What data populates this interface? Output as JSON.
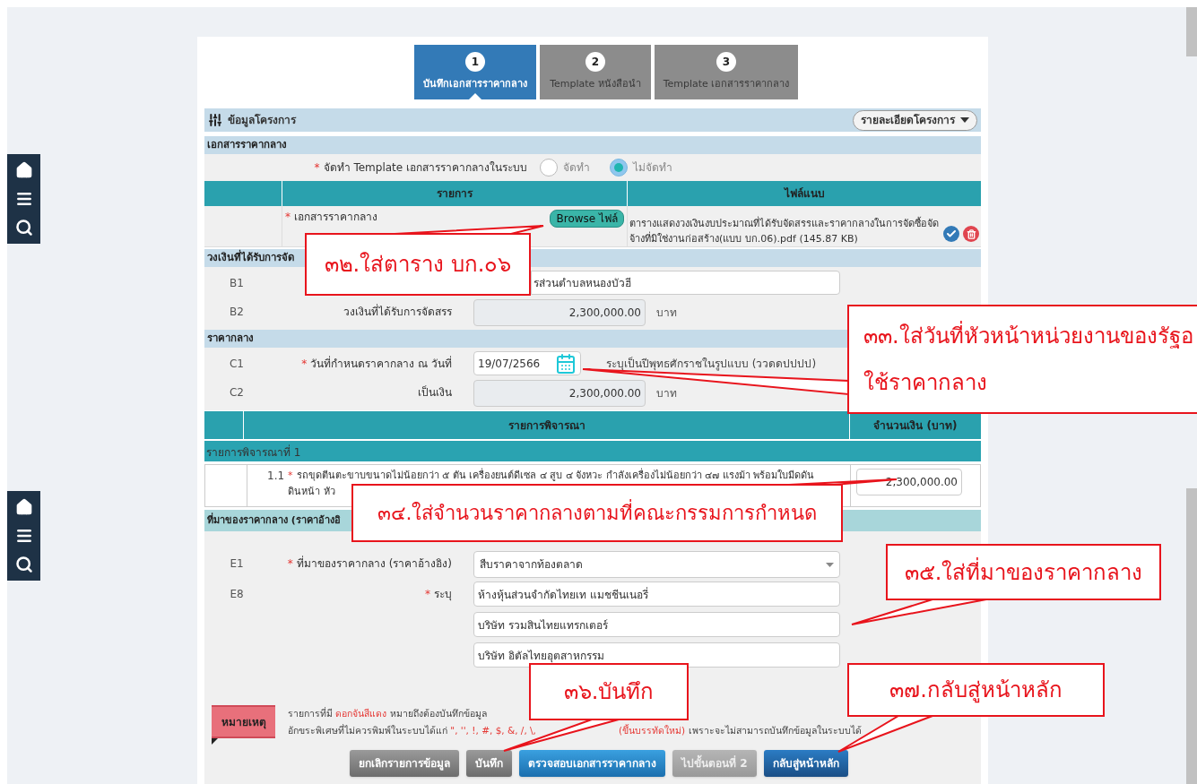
{
  "top_screen": {
    "steps": [
      {
        "number": "1",
        "label": "บันทึกเอกสารราคากลาง",
        "selected": true
      },
      {
        "number": "2",
        "label": "Template หนังสือนำ",
        "selected": false
      },
      {
        "number": "3",
        "label": "Template เอกสารราคากลาง",
        "selected": false
      }
    ],
    "project_bar": {
      "title": "ข้อมูลโครงการ",
      "dropdown": "รายละเอียดโครงการ"
    },
    "document_section": {
      "title": "เอกสารราคากลาง",
      "template_field": {
        "asterisk": "*",
        "label": "จัดทำ Template เอกสารราคากลางในระบบ",
        "options": [
          {
            "label": "จัดทำ",
            "selected": false
          },
          {
            "label": "ไม่จัดทำ",
            "selected": true
          }
        ]
      },
      "table": {
        "columns": [
          "รายการ",
          "ไฟล์แนบ"
        ],
        "row": {
          "asterisk": "*",
          "label": "เอกสารราคากลาง",
          "button": "Browse ไฟล์",
          "file": "ตารางแสดงวงเงินงบประมาณที่ได้รับจัดสรรและราคากลางในการจัดซื้อจัดจ้างที่มิใช่งานก่อสร้าง(แบบ บก.06).pdf (145.87 KB)"
        }
      }
    },
    "budget_section": {
      "title": "วงเงินที่ได้รับการจัด",
      "fields": [
        {
          "code": "B1",
          "kind": "text",
          "value": "รส่วนตำบลหนองบัวฮี"
        },
        {
          "code": "B2",
          "label": "วงเงินที่ได้รับการจัดสรร",
          "kind": "amount",
          "value": "2,300,000.00",
          "unit": "บาท"
        }
      ]
    },
    "price_section": {
      "title": "ราคากลาง",
      "fields": [
        {
          "code": "C1",
          "asterisk": "*",
          "label": "วันที่กำหนดราคากลาง ณ วันที่",
          "kind": "date",
          "value": "19/07/2566",
          "hint": "ระบุเป็นปีพุทธศักราชในรูปแบบ (ววดดปปปป)"
        },
        {
          "code": "C2",
          "label": "เป็นเงิน",
          "kind": "amount",
          "value": "2,300,000.00",
          "unit": "บาท"
        }
      ]
    },
    "items_table": {
      "columns": [
        "รายการพิจารณา",
        "จำนวนเงิน (บาท)"
      ],
      "group": "รายการพิจารณาที่ 1"
    }
  },
  "bottom_screen": {
    "item_row": {
      "number": "1.1",
      "asterisk": "*",
      "lines": [
        "รถขุดตีนตะขาบขนาดไม่น้อยกว่า ๕ ตัน เครื่องยนต์ดีเซล ๔ สูบ ๔ จังหวะ กำลังเครื่องไม่น้อยกว่า ๔๗ แรงม้า พร้อมใบมีดดัน",
        "ดินหน้า หัว"
      ],
      "amount": "2,300,000.00"
    },
    "source_section": {
      "title": "ที่มาของราคากลาง (ราคาอ้างอิ",
      "fields": [
        {
          "code": "E1",
          "asterisk": "*",
          "label": "ที่มาของราคากลาง (ราคาอ้างอิง)",
          "kind": "select",
          "value": "สืบราคาจากท้องตลาด"
        },
        {
          "code": "E8",
          "asterisk": "*",
          "label": "ระบุ",
          "kind": "multi",
          "values": [
            "ห้างหุ้นส่วนจำกัดไทยเท แมชชีนเนอรี่",
            "บริษัท รวมสินไทยแทรกเตอร์",
            "บริษัท อิตัลไทยอุตสาหกรรม"
          ]
        }
      ]
    },
    "note": {
      "tag": "หมายเหตุ",
      "lines": [
        [
          {
            "text": "รายการที่มี ",
            "kind": "plain"
          },
          {
            "text": "ดอกจันสีแดง",
            "kind": "highlight"
          },
          {
            "text": " หมายถึงต้องบันทึกข้อมูล",
            "kind": "plain"
          }
        ],
        [
          {
            "text": "อักขระพิเศษที่ไม่ควรพิมพ์ในระบบได้แก่ ",
            "kind": "plain"
          },
          {
            "text": "\", '', !, #, $, &, /, \\,",
            "kind": "highlight"
          },
          {
            "text": "(ขึ้นบรรทัดใหม่)",
            "kind": "highlight"
          },
          {
            "text": " เพราะจะไม่สามารถบันทึกข้อมูลในระบบได้",
            "kind": "plain"
          }
        ]
      ]
    },
    "buttons": [
      {
        "label": "ยกเลิกรายการข้อมูล",
        "kind": "secondary"
      },
      {
        "label": "บันทึก",
        "kind": "secondary"
      },
      {
        "label": "ตรวจสอบเอกสารราคากลาง",
        "kind": "primary"
      },
      {
        "label": "ไปขั้นตอนที่ 2",
        "kind": "disabled"
      },
      {
        "label": "กลับสู่หน้าหลัก",
        "kind": "dark"
      }
    ]
  },
  "callouts": [
    {
      "lines": [
        "๓๒.ใส่ตาราง บก.๐๖"
      ]
    },
    {
      "lines": [
        "๓๓.ใส่วันที่หัวหน้าหน่วยงานของรัฐอ",
        "ใช้ราคากลาง"
      ]
    },
    {
      "lines": [
        "๓๔.ใส่จำนวนราคากลางตามที่คณะกรรมการกำหนด"
      ]
    },
    {
      "lines": [
        "๓๕.ใส่ที่มาของราคากลาง"
      ]
    },
    {
      "lines": [
        "๓๖.บันทึก"
      ]
    },
    {
      "lines": [
        "๓๗.กลับสู่หน้าหลัก"
      ]
    }
  ]
}
